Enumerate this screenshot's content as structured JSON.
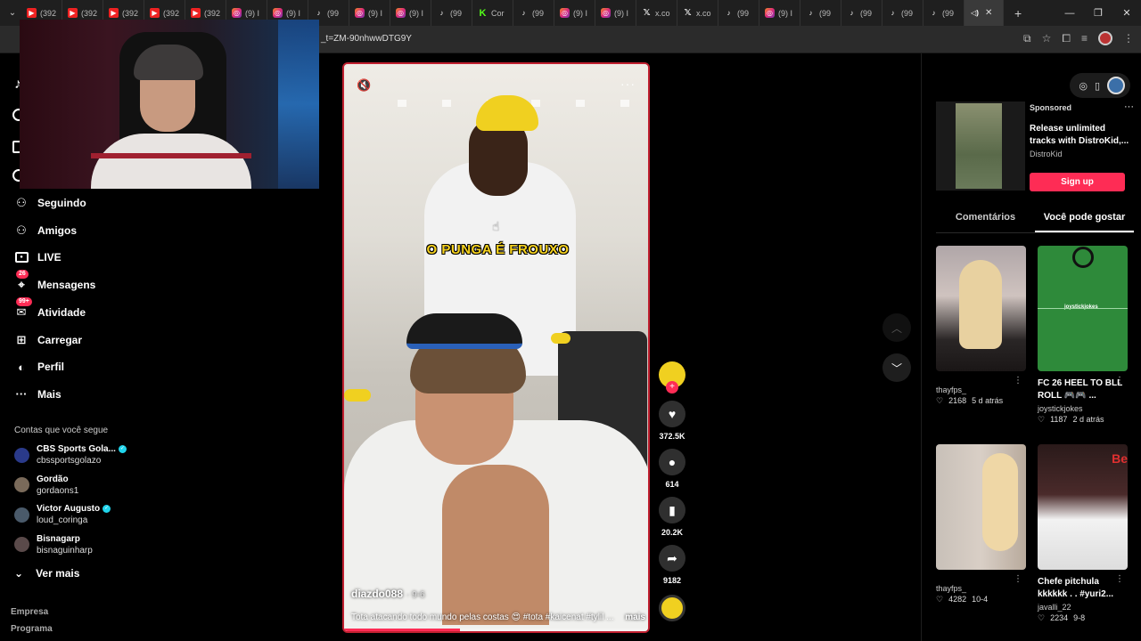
{
  "browser": {
    "tabs": [
      {
        "icon": "youtube",
        "label": "(392"
      },
      {
        "icon": "youtube",
        "label": "(392"
      },
      {
        "icon": "youtube",
        "label": "(392"
      },
      {
        "icon": "youtube",
        "label": "(392"
      },
      {
        "icon": "youtube",
        "label": "(392"
      },
      {
        "icon": "instagram",
        "label": "(9) I"
      },
      {
        "icon": "instagram",
        "label": "(9) I"
      },
      {
        "icon": "tiktok",
        "label": "(99"
      },
      {
        "icon": "instagram",
        "label": "(9) I"
      },
      {
        "icon": "instagram",
        "label": "(9) I"
      },
      {
        "icon": "tiktok",
        "label": "(99"
      },
      {
        "icon": "kick",
        "label": "Cor"
      },
      {
        "icon": "tiktok",
        "label": "(99"
      },
      {
        "icon": "instagram",
        "label": "(9) I"
      },
      {
        "icon": "instagram",
        "label": "(9) I"
      },
      {
        "icon": "x",
        "label": "x.co"
      },
      {
        "icon": "x",
        "label": "x.co"
      },
      {
        "icon": "tiktok",
        "label": "(99"
      },
      {
        "icon": "instagram",
        "label": "(9) I"
      },
      {
        "icon": "tiktok",
        "label": "(99"
      },
      {
        "icon": "tiktok",
        "label": "(99"
      },
      {
        "icon": "tiktok",
        "label": "(99"
      },
      {
        "icon": "tiktok",
        "label": "(99"
      }
    ],
    "url": "_t=ZM-90nhwwDTG9Y"
  },
  "sidebar": {
    "logo": "tiktok-logo",
    "items": [
      {
        "label": "Seguindo",
        "icon": "following-icon"
      },
      {
        "label": "Amigos",
        "icon": "friends-icon"
      },
      {
        "label": "LIVE",
        "icon": "live-icon"
      },
      {
        "label": "Mensagens",
        "icon": "messages-icon",
        "badge": "26"
      },
      {
        "label": "Atividade",
        "icon": "activity-icon",
        "badge": "99+"
      },
      {
        "label": "Carregar",
        "icon": "upload-icon"
      },
      {
        "label": "Perfil",
        "icon": "profile-icon"
      },
      {
        "label": "Mais",
        "icon": "more-icon"
      }
    ],
    "following_title": "Contas que você segue",
    "accounts": [
      {
        "name": "CBS Sports Gola...",
        "user": "cbssportsgolazo",
        "verified": true
      },
      {
        "name": "Gordão",
        "user": "gordaons1",
        "verified": false
      },
      {
        "name": "Victor Augusto",
        "user": "loud_coringa",
        "verified": true
      },
      {
        "name": "Bisnagarp",
        "user": "bisnaguinharp",
        "verified": false
      }
    ],
    "see_more": "Ver mais",
    "footer": [
      "Empresa",
      "Programa"
    ]
  },
  "video": {
    "caption_overlay": "O PUNGA É FROUXO",
    "author": "diazdo088",
    "date": "· 9-6",
    "description": "Tota atacando todo mundo pelas costas 😍 #tota #kaicenat #tylil ...",
    "more": "mais",
    "progress_fraction": 0.38,
    "likes": "372.5K",
    "comments": "614",
    "saves": "20.2K",
    "shares": "9182"
  },
  "ad": {
    "label": "Sponsored",
    "title": "Release unlimited tracks with DistroKid,...",
    "brand": "DistroKid",
    "cta": "Sign up"
  },
  "right_tabs": [
    {
      "label": "Comentários",
      "active": false
    },
    {
      "label": "Você pode gostar",
      "active": true
    }
  ],
  "suggestions": [
    {
      "title": "",
      "user": "thayfps_",
      "likes": "2168",
      "date": "5 d atrás",
      "thumb": "girl"
    },
    {
      "title": "FC 26 HEEL TO BLL ROLL 🎮🎮 ...",
      "user": "joystickjokes",
      "likes": "1187",
      "date": "2 d atrás",
      "thumb": "soccer"
    },
    {
      "title": "",
      "user": "thayfps_",
      "likes": "4282",
      "date": "10-4",
      "thumb": "women"
    },
    {
      "title": "Chefe pitchula kkkkkk . . #yuri2...",
      "user": "javalli_22",
      "likes": "2234",
      "date": "9-8",
      "thumb": "chef"
    }
  ],
  "thumb_text": {
    "soccer": "joystickjokes",
    "chef": "Be"
  }
}
